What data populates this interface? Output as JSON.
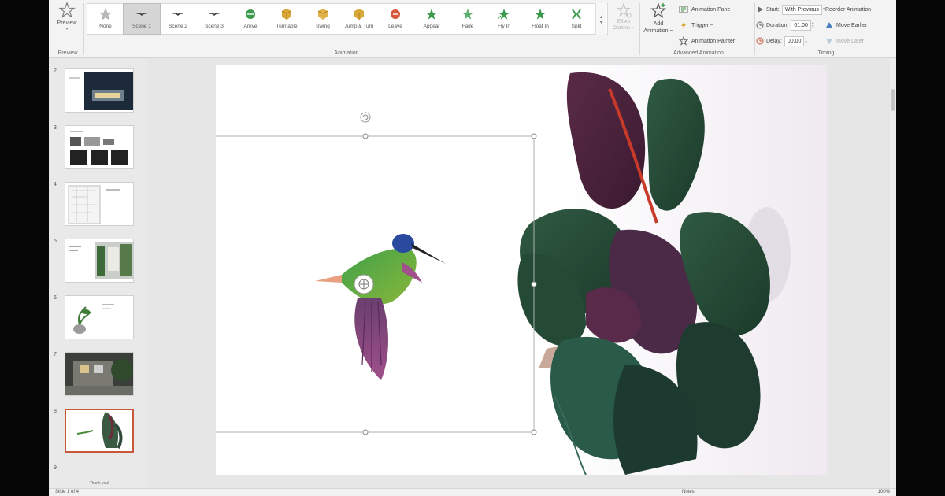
{
  "ribbon": {
    "preview": {
      "label": "Preview",
      "group_label": "Preview"
    },
    "animation_group_label": "Animation",
    "gallery": [
      {
        "label": "None",
        "icon": "star-outline-icon",
        "selected": false
      },
      {
        "label": "Scene 1",
        "icon": "bird-scene-icon",
        "selected": true
      },
      {
        "label": "Scene 2",
        "icon": "bird-scene-icon",
        "selected": false
      },
      {
        "label": "Scene 3",
        "icon": "bird-scene-icon",
        "selected": false
      },
      {
        "label": "Arrive",
        "icon": "arrive-icon",
        "selected": false
      },
      {
        "label": "Turntable",
        "icon": "turntable-icon",
        "selected": false
      },
      {
        "label": "Swing",
        "icon": "swing-icon",
        "selected": false
      },
      {
        "label": "Jump & Turn",
        "icon": "jump-turn-icon",
        "selected": false
      },
      {
        "label": "Leave",
        "icon": "leave-icon",
        "selected": false
      },
      {
        "label": "Appear",
        "icon": "appear-icon",
        "selected": false
      },
      {
        "label": "Fade",
        "icon": "fade-icon",
        "selected": false
      },
      {
        "label": "Fly In",
        "icon": "fly-in-icon",
        "selected": false
      },
      {
        "label": "Float In",
        "icon": "float-in-icon",
        "selected": false
      },
      {
        "label": "Split",
        "icon": "split-icon",
        "selected": false
      }
    ],
    "effect_options": {
      "line1": "Effect",
      "line2": "Options ~"
    },
    "add_animation": {
      "line1": "Add",
      "line2": "Animation ~"
    },
    "advanced": {
      "group_label": "Advanced Animation",
      "animation_pane": "Animation Pane",
      "trigger": "Trigger ~",
      "animation_painter": "Animation Painter"
    },
    "timing": {
      "group_label": "Timing",
      "start_label": "Start:",
      "start_value": "With Previous",
      "duration_label": "Duration:",
      "duration_value": "01.00",
      "delay_label": "Delay:",
      "delay_value": "00.00"
    },
    "reorder": {
      "title": "Reorder Animation",
      "move_earlier": "Move Earlier",
      "move_later": "Move Later"
    },
    "colors": {
      "accent": "#c8583a",
      "green_effect": "#3b9a4c",
      "gold_effect": "#d9a83a"
    }
  },
  "thumbnails": [
    {
      "num": "2",
      "kind": "dark-building"
    },
    {
      "num": "3",
      "kind": "three-dark-tiles"
    },
    {
      "num": "4",
      "kind": "floor-plan"
    },
    {
      "num": "5",
      "kind": "green-facade"
    },
    {
      "num": "6",
      "kind": "plant-pot"
    },
    {
      "num": "7",
      "kind": "courtyard"
    },
    {
      "num": "8",
      "kind": "hummingbird-leaves"
    },
    {
      "num": "9",
      "partial_text": "Thank you!"
    }
  ],
  "status": {
    "slide_of": "Slide 1 of 4",
    "notes": "Notes",
    "zoom": "100%"
  }
}
